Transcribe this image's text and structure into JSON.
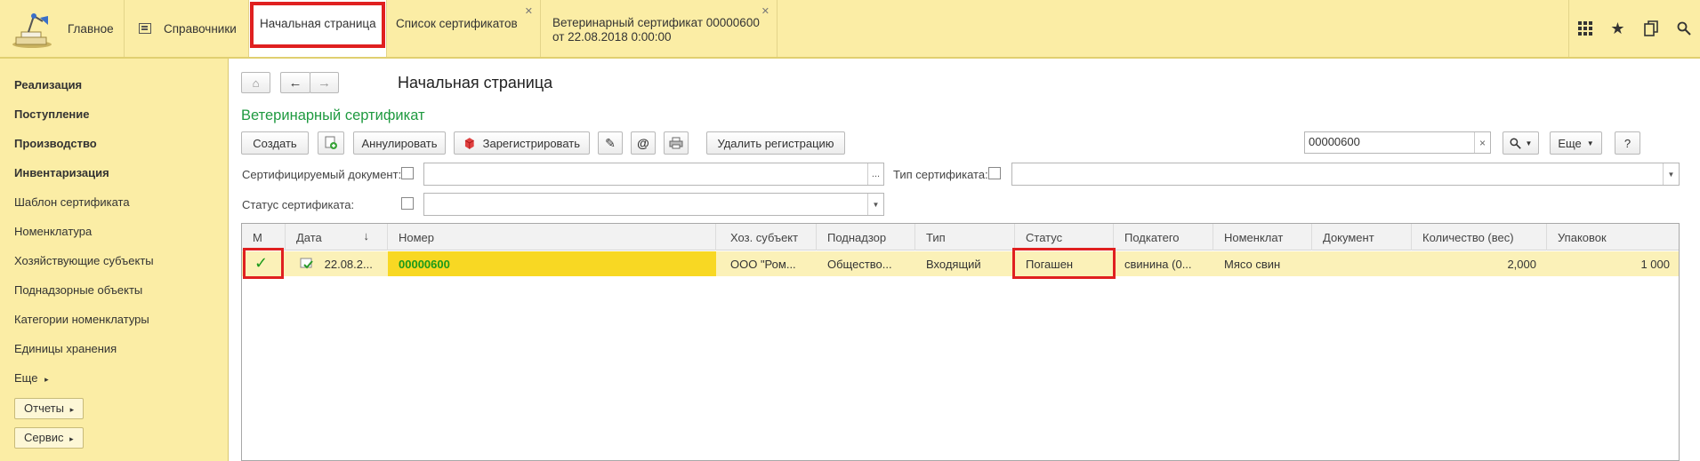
{
  "topbar": {
    "sections": [
      {
        "label": "Главное"
      },
      {
        "label": "Справочники"
      }
    ],
    "tabs": [
      {
        "label": "Начальная страница"
      },
      {
        "label": "Список сертификатов"
      },
      {
        "label": "Ветеринарный сертификат 00000600",
        "label2": "от 22.08.2018 0:00:00"
      }
    ],
    "icons": [
      "apps-grid-icon",
      "star-icon",
      "history-icon",
      "search-icon"
    ]
  },
  "sidebar": {
    "items": [
      {
        "label": "Реализация"
      },
      {
        "label": "Поступление"
      },
      {
        "label": "Производство"
      },
      {
        "label": "Инвентаризация"
      },
      {
        "label": "Шаблон сертификата"
      },
      {
        "label": "Номенклатура"
      },
      {
        "label": "Хозяйствующие субъекты"
      },
      {
        "label": "Поднадзорные объекты"
      },
      {
        "label": "Категории номенклатуры"
      },
      {
        "label": "Единицы хранения"
      },
      {
        "label": "Еще"
      }
    ],
    "buttons": [
      {
        "label": "Отчеты"
      },
      {
        "label": "Сервис"
      }
    ]
  },
  "main": {
    "page_title": "Начальная страница",
    "form_title": "Ветеринарный сертификат",
    "toolbar": {
      "create": "Создать",
      "annul": "Аннулировать",
      "register": "Зарегистрировать",
      "delete_registration": "Удалить регистрацию",
      "more": "Еще",
      "help": "?",
      "search_value": "00000600",
      "search_clear": "×"
    },
    "filters": {
      "doc_label": "Сертифицируемый документ:",
      "doc_value": "",
      "doc_btn": "...",
      "type_label": "Тип сертификата:",
      "type_value": "",
      "status_label": "Статус сертификата:",
      "status_value": ""
    },
    "table": {
      "columns": [
        "М",
        "Дата",
        "Номер",
        "Хоз. субъект",
        "Поднадзор",
        "Тип",
        "Статус",
        "Подкатего",
        "Номенклат",
        "Документ",
        "Количество (вес)",
        "Упаковок"
      ],
      "rows": [
        {
          "date": "22.08.2...",
          "number": "00000600",
          "subject": "ООО \"Ром...",
          "supervised": "Общество...",
          "type": "Входящий",
          "status": "Погашен",
          "subcategory": "свинина (0...",
          "nomenclature": "Мясо свин",
          "document": "",
          "quantity": "2,000",
          "packages": "1 000"
        }
      ]
    }
  }
}
